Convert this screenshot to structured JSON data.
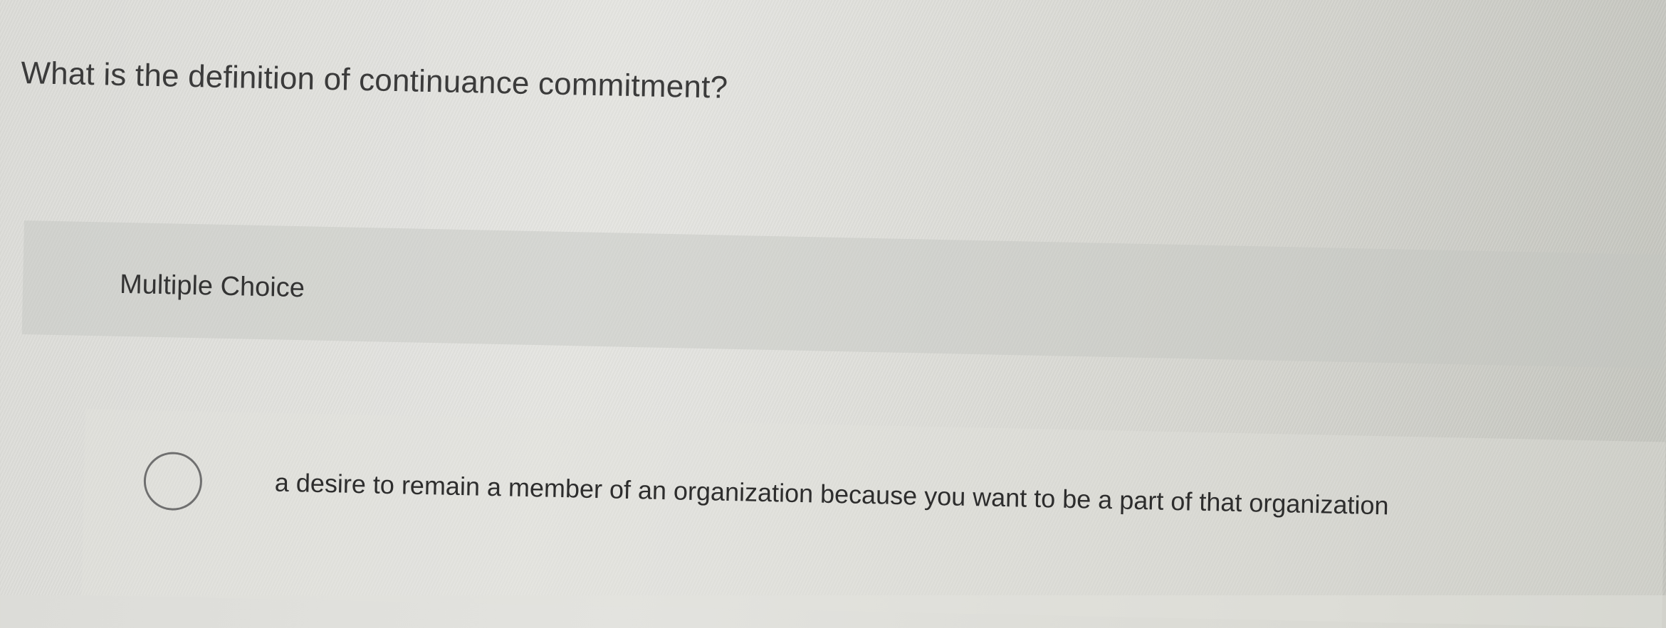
{
  "question": {
    "text": "What is the definition of continuance commitment?"
  },
  "answer_section": {
    "type_label": "Multiple Choice",
    "options": [
      {
        "text": "a desire to remain a member of an organization because you want to be a part of that organization",
        "selected": false
      }
    ]
  }
}
